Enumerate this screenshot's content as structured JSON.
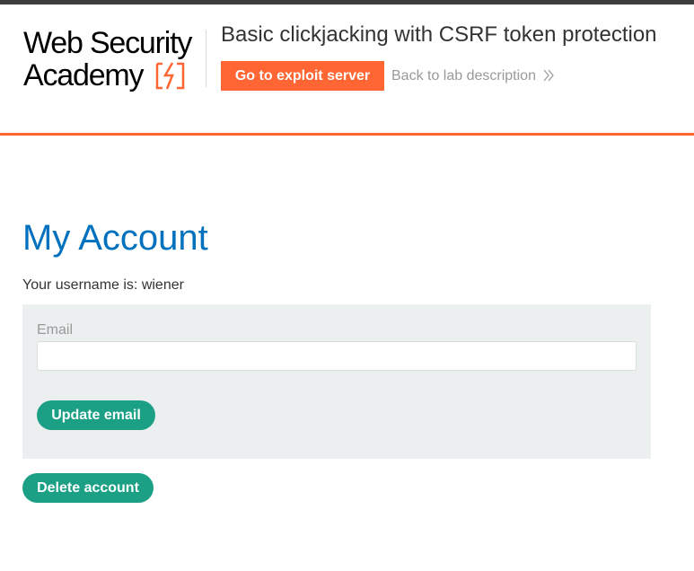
{
  "header": {
    "logo": {
      "line1": "Web Security",
      "line2": "Academy",
      "icon": "lightning-bolt-icon",
      "brand_color": "#ff6633"
    },
    "lab_title": "Basic clickjacking with CSRF token protection",
    "exploit_button_label": "Go to exploit server",
    "back_link_label": "Back to lab description",
    "back_link_icon": "double-chevron-right-icon"
  },
  "main": {
    "title": "My Account",
    "username_text": "Your username is: wiener",
    "email_form": {
      "label": "Email",
      "value": "",
      "placeholder": "",
      "submit_label": "Update email"
    },
    "delete_button_label": "Delete account"
  },
  "colors": {
    "accent": "#ff6633",
    "title_blue": "#0071bc",
    "button_green": "#1ba085",
    "form_background": "#ebeff0",
    "muted_text": "#999999"
  }
}
